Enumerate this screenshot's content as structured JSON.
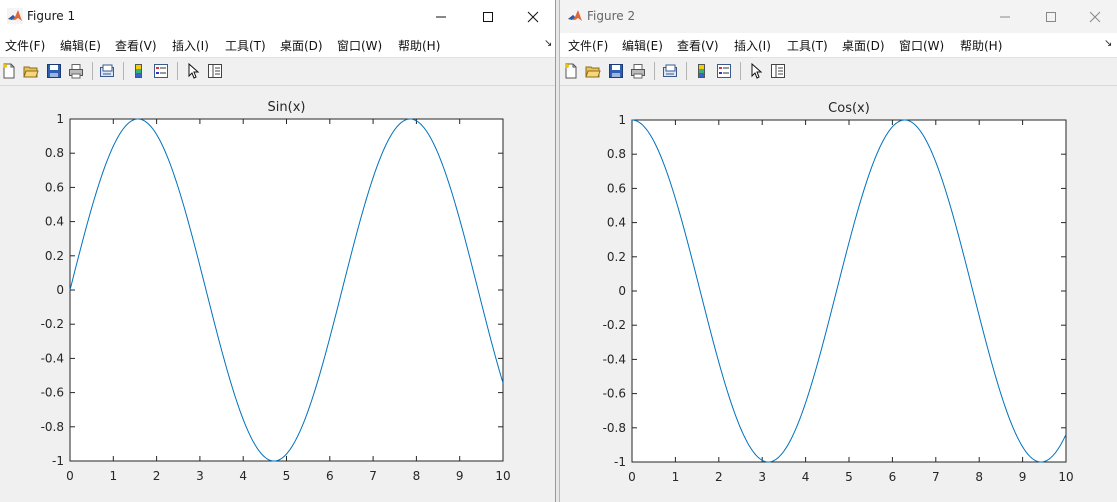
{
  "desktop": {
    "background": "#e8e8e8"
  },
  "windows": [
    {
      "title": "Figure 1",
      "menu": [
        "文件(F)",
        "编辑(E)",
        "查看(V)",
        "插入(I)",
        "工具(T)",
        "桌面(D)",
        "窗口(W)",
        "帮助(H)"
      ],
      "menu_arrow": "↘",
      "toolbar_icons": [
        "new-figure-icon",
        "open-file-icon",
        "save-icon",
        "print-icon",
        "link-figure-icon",
        "colorbar-icon",
        "legend-icon",
        "pointer-icon",
        "property-editor-icon"
      ]
    },
    {
      "title": "Figure 2",
      "menu": [
        "文件(F)",
        "编辑(E)",
        "查看(V)",
        "插入(I)",
        "工具(T)",
        "桌面(D)",
        "窗口(W)",
        "帮助(H)"
      ],
      "menu_arrow": "↘",
      "toolbar_icons": [
        "new-figure-icon",
        "open-file-icon",
        "save-icon",
        "print-icon",
        "link-figure-icon",
        "colorbar-icon",
        "legend-icon",
        "pointer-icon",
        "property-editor-icon"
      ]
    }
  ],
  "colors": {
    "line": "#0072BD",
    "axes": "#262626",
    "plot_bg": "#ffffff",
    "figure_bg": "#f0f0f0"
  },
  "chart_data": [
    {
      "type": "line",
      "title": "Sin(x)",
      "function": "sin",
      "x": [
        0,
        0.5,
        1,
        1.5,
        2,
        2.5,
        3,
        3.5,
        4,
        4.5,
        5,
        5.5,
        6,
        6.5,
        7,
        7.5,
        8,
        8.5,
        9,
        9.5,
        10
      ],
      "y": [
        0,
        0.479,
        0.841,
        0.997,
        0.909,
        0.598,
        0.141,
        -0.351,
        -0.757,
        -0.978,
        -0.959,
        -0.706,
        -0.279,
        0.215,
        0.657,
        0.938,
        0.989,
        0.798,
        0.412,
        -0.075,
        -0.544
      ],
      "xlim": [
        0,
        10
      ],
      "ylim": [
        -1,
        1
      ],
      "xticks": [
        "0",
        "1",
        "2",
        "3",
        "4",
        "5",
        "6",
        "7",
        "8",
        "9",
        "10"
      ],
      "yticks": [
        "1",
        "0.8",
        "0.6",
        "0.4",
        "0.2",
        "0",
        "-0.2",
        "-0.4",
        "-0.6",
        "-0.8",
        "-1"
      ],
      "xlabel": "",
      "ylabel": "",
      "grid": false
    },
    {
      "type": "line",
      "title": "Cos(x)",
      "function": "cos",
      "x": [
        0,
        0.5,
        1,
        1.5,
        2,
        2.5,
        3,
        3.5,
        4,
        4.5,
        5,
        5.5,
        6,
        6.5,
        7,
        7.5,
        8,
        8.5,
        9,
        9.5,
        10
      ],
      "y": [
        1,
        0.878,
        0.54,
        0.071,
        -0.416,
        -0.801,
        -0.99,
        -0.936,
        -0.654,
        -0.211,
        0.284,
        0.709,
        0.96,
        0.977,
        0.754,
        0.347,
        -0.146,
        -0.602,
        -0.911,
        -0.997,
        -0.839
      ],
      "xlim": [
        0,
        10
      ],
      "ylim": [
        -1,
        1
      ],
      "xticks": [
        "0",
        "1",
        "2",
        "3",
        "4",
        "5",
        "6",
        "7",
        "8",
        "9",
        "10"
      ],
      "yticks": [
        "1",
        "0.8",
        "0.6",
        "0.4",
        "0.2",
        "0",
        "-0.2",
        "-0.4",
        "-0.6",
        "-0.8",
        "-1"
      ],
      "xlabel": "",
      "ylabel": "",
      "grid": false
    }
  ]
}
